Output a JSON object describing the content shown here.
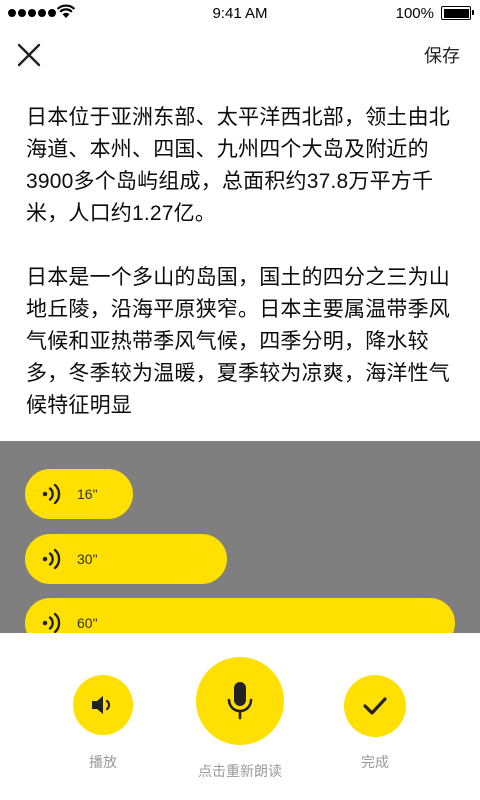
{
  "status_bar": {
    "time": "9:41 AM",
    "battery_percent": "100%",
    "battery_level": 1.0,
    "signal_dots": 5
  },
  "nav": {
    "close_icon": "close-icon",
    "save_label": "保存"
  },
  "article": {
    "paragraphs": [
      "日本位于亚洲东部、太平洋西北部，领土由北海道、本州、四国、九州四个大岛及附近的3900多个岛屿组成，总面积约37.8万平方千米，人口约1.27亿。",
      "日本是一个多山的岛国，国土的四分之三为山地丘陵，沿海平原狭窄。日本主要属温带季风气候和亚热带季风气候，四季分明，降水较多，冬季较为温暖，夏季较为凉爽，海洋性气候特征明显"
    ]
  },
  "durations": [
    {
      "label": "16\"",
      "icon": "sound-wave-icon"
    },
    {
      "label": "30\"",
      "icon": "sound-wave-icon"
    },
    {
      "label": "60\"",
      "icon": "sound-wave-icon"
    }
  ],
  "controls": {
    "play_label": "播放",
    "play_icon": "speaker-icon",
    "record_label": "点击重新朗读",
    "record_icon": "microphone-icon",
    "done_label": "完成",
    "done_icon": "checkmark-icon"
  },
  "colors": {
    "accent": "#ffe000",
    "overlay": "rgba(0,0,0,0.5)",
    "label_gray": "#9a9a9a"
  }
}
